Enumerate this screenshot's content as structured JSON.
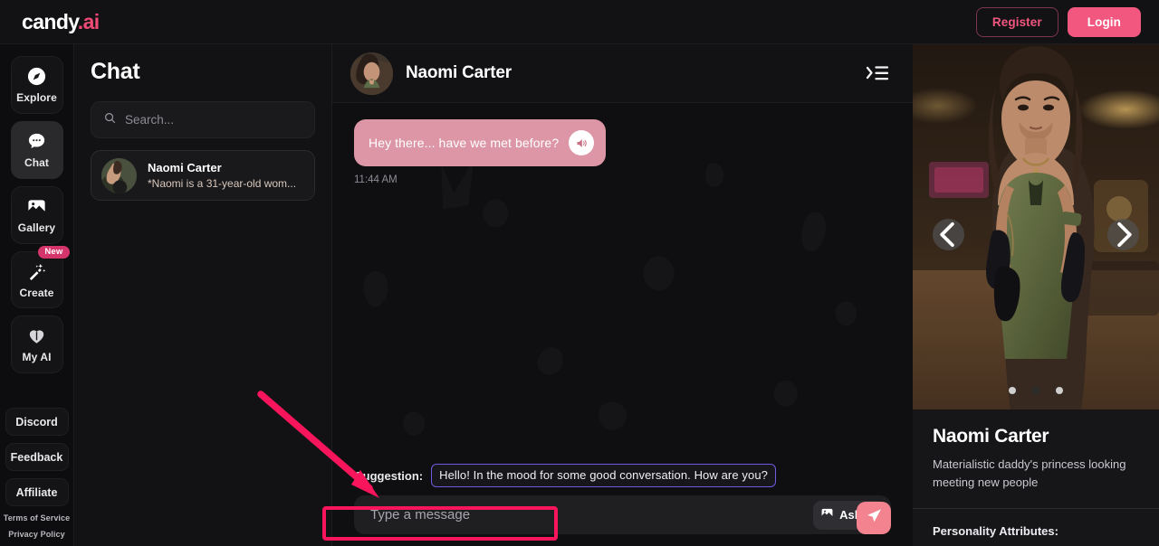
{
  "topbar": {
    "logo_main": "candy",
    "logo_suffix": ".ai",
    "register_label": "Register",
    "login_label": "Login",
    "accent": "#f2577f"
  },
  "rail": {
    "items": [
      {
        "label": "Explore",
        "icon": "compass-icon",
        "active": false,
        "badge": null
      },
      {
        "label": "Chat",
        "icon": "chat-bubble-icon",
        "active": true,
        "badge": null
      },
      {
        "label": "Gallery",
        "icon": "image-icon",
        "active": false,
        "badge": null
      },
      {
        "label": "Create",
        "icon": "magic-wand-icon",
        "active": false,
        "badge": "New"
      },
      {
        "label": "My AI",
        "icon": "heart-icon",
        "active": false,
        "badge": null
      }
    ],
    "links": [
      {
        "label": "Discord"
      },
      {
        "label": "Feedback"
      },
      {
        "label": "Affiliate"
      }
    ],
    "footer_links": [
      {
        "label": "Terms of Service"
      },
      {
        "label": "Privacy Policy"
      }
    ]
  },
  "chatlist": {
    "title": "Chat",
    "search_placeholder": "Search...",
    "search_value": "",
    "conversations": [
      {
        "name": "Naomi Carter",
        "snippet": "*Naomi is a 31-year-old wom...",
        "selected": true
      }
    ]
  },
  "chat": {
    "header_name": "Naomi Carter",
    "collapse_icon": "collapse-panel-icon",
    "messages": [
      {
        "text": "Hey there... have we met before?",
        "time": "11:44 AM",
        "from": "assistant",
        "speaker_icon": "speaker-icon"
      }
    ],
    "suggestion_label": "Suggestion:",
    "suggestion_text": "Hello! In the mood for some good conversation. How are you?",
    "suggestion_border_color": "#6f5ae0",
    "input_placeholder": "Type a message",
    "input_value": "",
    "ask_label": "Ask",
    "ask_icon": "image-icon",
    "ask_chevron": "chevron-down-icon",
    "send_icon": "send-icon"
  },
  "profile": {
    "name": "Naomi Carter",
    "description": "Materialistic daddy's princess looking meeting new people",
    "attributes_heading": "Personality Attributes:",
    "carousel": {
      "prev_icon": "chevron-left-icon",
      "next_icon": "chevron-right-icon",
      "dots": [
        {
          "active": true
        },
        {
          "active": false
        },
        {
          "active": true
        }
      ]
    }
  },
  "annotations": {
    "highlight_color": "#f8155c",
    "arrow_target": "message-input",
    "box_target": "message-input"
  }
}
